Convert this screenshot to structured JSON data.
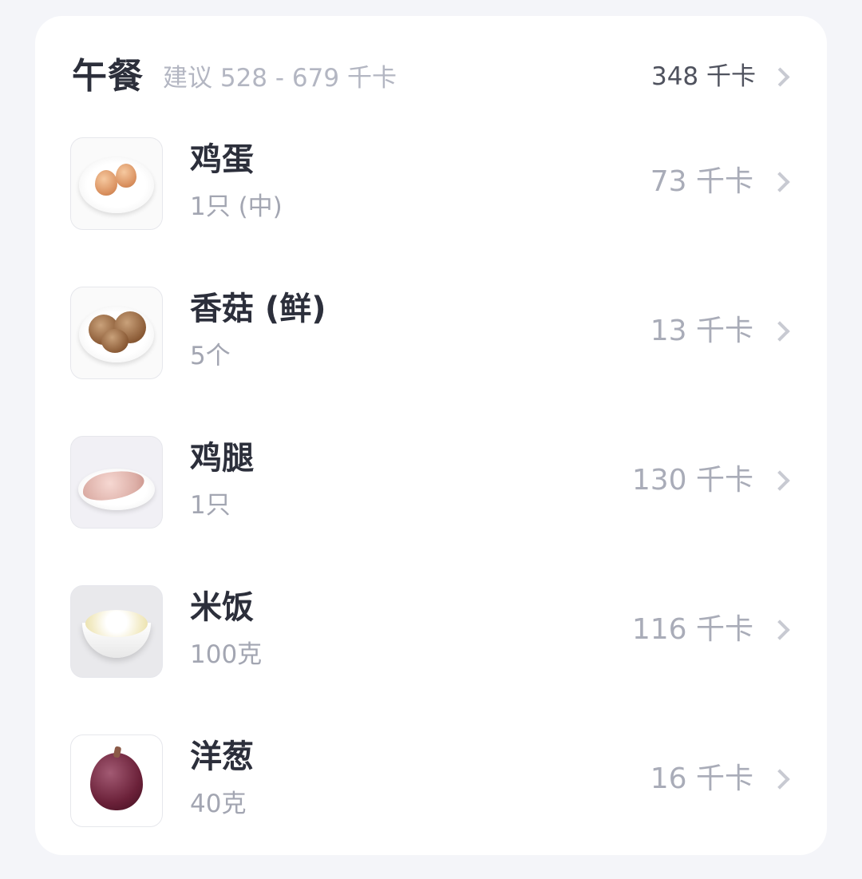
{
  "meal": {
    "title": "午餐",
    "suggestion": "建议 528 - 679 千卡",
    "total": "348 千卡"
  },
  "items": [
    {
      "name": "鸡蛋",
      "amount": "1只 (中)",
      "kcal": "73 千卡",
      "icon": "egg-icon"
    },
    {
      "name": "香菇 (鲜)",
      "amount": "5个",
      "kcal": "13 千卡",
      "icon": "mushroom-icon"
    },
    {
      "name": "鸡腿",
      "amount": "1只",
      "kcal": "130 千卡",
      "icon": "chicken-leg-icon"
    },
    {
      "name": "米饭",
      "amount": "100克",
      "kcal": "116 千卡",
      "icon": "rice-icon"
    },
    {
      "name": "洋葱",
      "amount": "40克",
      "kcal": "16 千卡",
      "icon": "onion-icon"
    }
  ],
  "colors": {
    "background": "#f4f5f9",
    "card": "#ffffff",
    "title": "#2c2f3b",
    "muted": "#a9acb8"
  }
}
